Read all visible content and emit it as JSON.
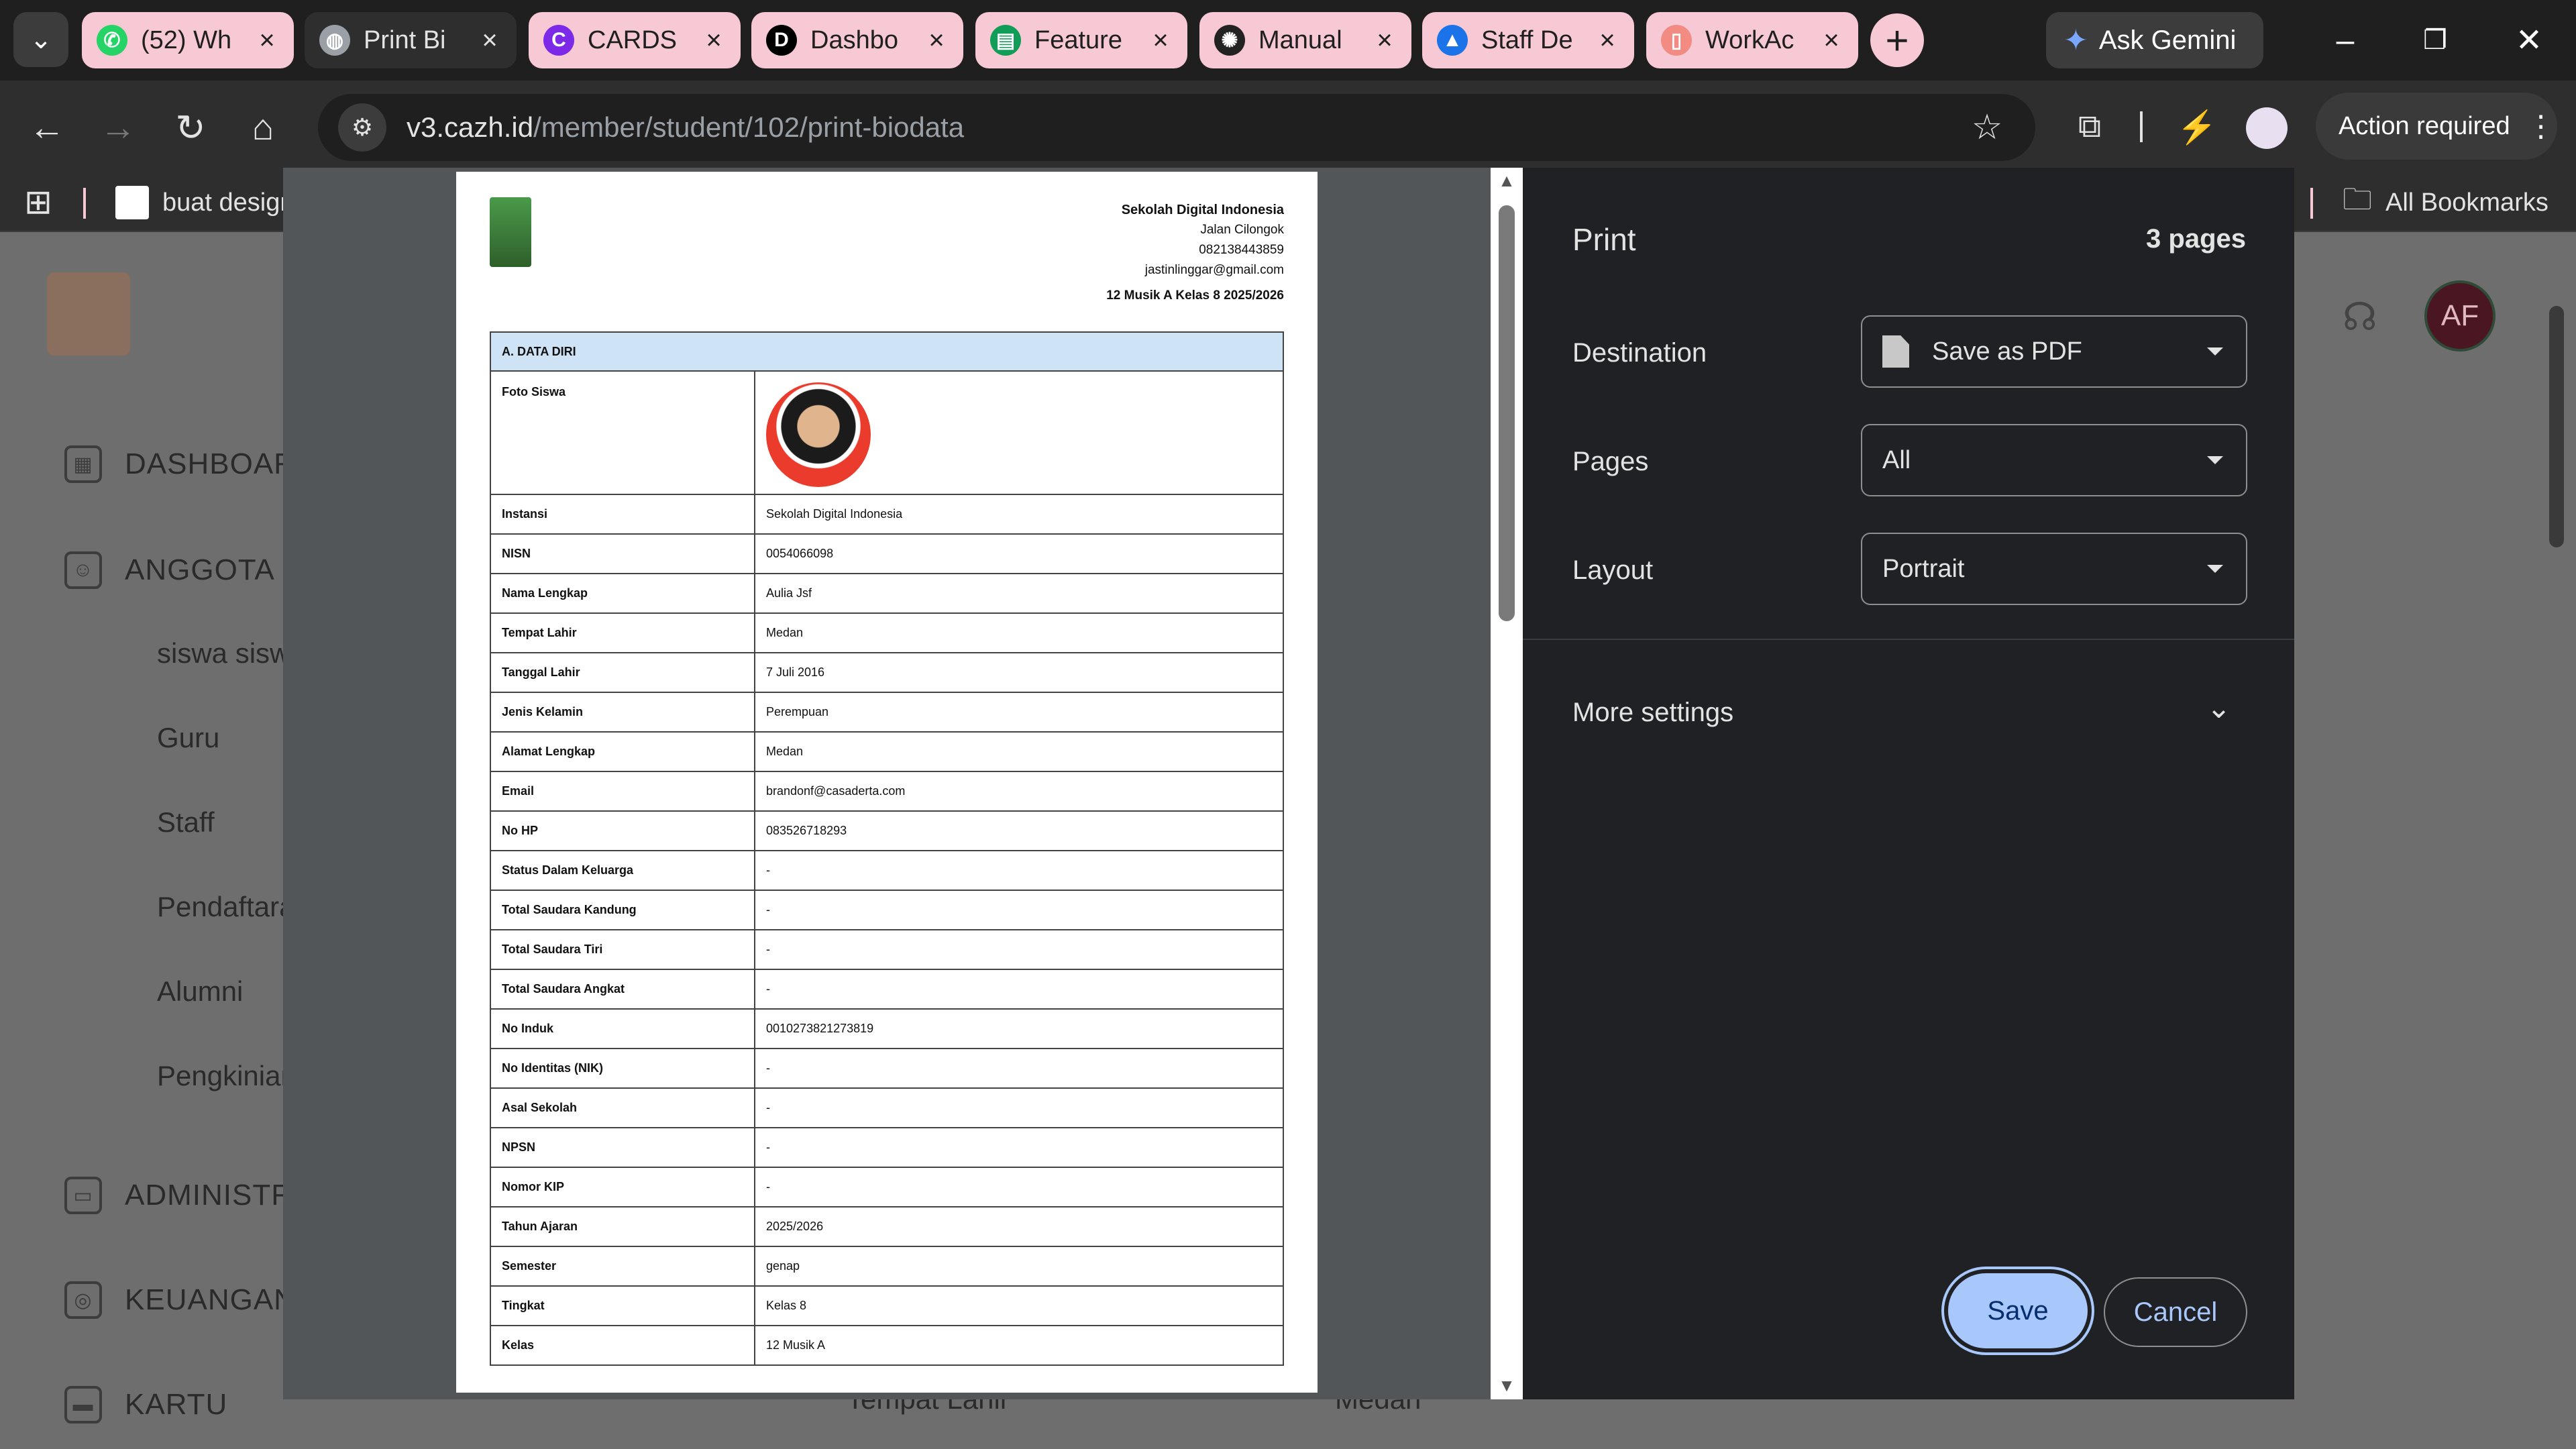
{
  "browser": {
    "tabs": [
      {
        "label": "(52) Wh",
        "icon": "whatsapp-icon",
        "icon_color": "#25D366",
        "glyph": "✆"
      },
      {
        "label": "Print Bi",
        "icon": "globe-icon",
        "icon_color": "#9aa0a6",
        "glyph": "◍",
        "active": true
      },
      {
        "label": "CARDS",
        "icon": "canva-icon",
        "icon_color": "#7d2ae8",
        "glyph": "C"
      },
      {
        "label": "Dashbo",
        "icon": "d-letter-icon",
        "icon_color": "#000000",
        "glyph": "D"
      },
      {
        "label": "Feature",
        "icon": "sheets-icon",
        "icon_color": "#0f9d58",
        "glyph": "▤"
      },
      {
        "label": "Manual",
        "icon": "openai-icon",
        "icon_color": "#222222",
        "glyph": "✺"
      },
      {
        "label": "Staff De",
        "icon": "google-drive-icon",
        "icon_color": "#1a73e8",
        "glyph": "▲"
      },
      {
        "label": "WorkAc",
        "icon": "document-icon",
        "icon_color": "#f28b82",
        "glyph": "▯"
      }
    ],
    "new_tab": "+",
    "ask_gemini": "Ask Gemini",
    "url_host": "v3.cazh.id",
    "url_path": "/member/student/102/print-biodata",
    "action_required": "Action required",
    "bookmark_item": "buat design",
    "all_bookmarks": "All Bookmarks"
  },
  "background_page": {
    "menu": [
      {
        "label": "DASHBOARD",
        "icon": "dashboard-icon"
      },
      {
        "label": "ANGGOTA",
        "icon": "users-icon"
      },
      {
        "label": "ADMINISTRASI",
        "icon": "folder-icon"
      },
      {
        "label": "KEUANGAN",
        "icon": "money-icon"
      },
      {
        "label": "KARTU",
        "icon": "card-icon"
      }
    ],
    "anggota_sub": [
      "siswa siswi",
      "Guru",
      "Staff",
      "Pendaftaran",
      "Alumni",
      "Pengkinian"
    ],
    "avatar_initials": "AF",
    "bg_row_label": "Tempat Lahir",
    "bg_row_value": "Medan"
  },
  "print": {
    "title": "Print",
    "pages_count": "3 pages",
    "destination_label": "Destination",
    "destination_value": "Save as PDF",
    "pages_label": "Pages",
    "pages_value": "All",
    "layout_label": "Layout",
    "layout_value": "Portrait",
    "more_settings": "More settings",
    "save": "Save",
    "cancel": "Cancel",
    "accent": "#a8c7fa"
  },
  "document": {
    "school": "Sekolah Digital Indonesia",
    "address": "Jalan Cilongok",
    "phone": "082138443859",
    "email": "jastinlinggar@gmail.com",
    "class_year": "12 Musik A Kelas 8 2025/2026",
    "section_title": "A. DATA DIRI",
    "photo_label": "Foto Siswa",
    "rows": [
      {
        "k": "Instansi",
        "v": "Sekolah Digital Indonesia"
      },
      {
        "k": "NISN",
        "v": "0054066098"
      },
      {
        "k": "Nama Lengkap",
        "v": "Aulia Jsf"
      },
      {
        "k": "Tempat Lahir",
        "v": "Medan"
      },
      {
        "k": "Tanggal Lahir",
        "v": "7 Juli 2016"
      },
      {
        "k": "Jenis Kelamin",
        "v": "Perempuan"
      },
      {
        "k": "Alamat Lengkap",
        "v": "Medan"
      },
      {
        "k": "Email",
        "v": "brandonf@casaderta.com"
      },
      {
        "k": "No HP",
        "v": "083526718293"
      },
      {
        "k": "Status Dalam Keluarga",
        "v": "-"
      },
      {
        "k": "Total Saudara Kandung",
        "v": "-"
      },
      {
        "k": "Total Saudara Tiri",
        "v": "-"
      },
      {
        "k": "Total Saudara Angkat",
        "v": "-"
      },
      {
        "k": "No Induk",
        "v": "0010273821273819"
      },
      {
        "k": "No Identitas (NIK)",
        "v": "-"
      },
      {
        "k": "Asal Sekolah",
        "v": "-"
      },
      {
        "k": "NPSN",
        "v": "-"
      },
      {
        "k": "Nomor KIP",
        "v": "-"
      },
      {
        "k": "Tahun Ajaran",
        "v": "2025/2026"
      },
      {
        "k": "Semester",
        "v": "genap"
      },
      {
        "k": "Tingkat",
        "v": "Kelas 8"
      },
      {
        "k": "Kelas",
        "v": "12 Musik A"
      }
    ]
  }
}
